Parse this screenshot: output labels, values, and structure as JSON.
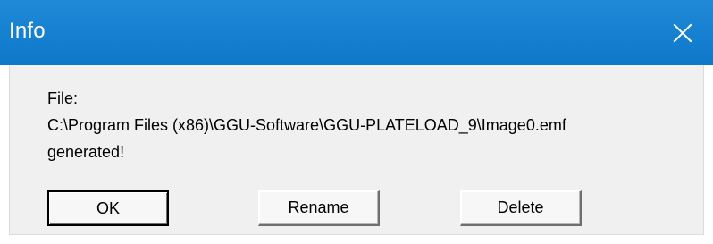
{
  "window": {
    "title": "Info",
    "close_icon": "close-icon"
  },
  "message": {
    "line1": "File:",
    "line2": "C:\\Program Files (x86)\\GGU-Software\\GGU-PLATELOAD_9\\Image0.emf",
    "line3": "generated!"
  },
  "buttons": {
    "ok_label": "OK",
    "rename_label": "Rename",
    "delete_label": "Delete"
  },
  "colors": {
    "titlebar": "#1a84d4",
    "title_text": "#ffffff",
    "client_bg": "#f0f0f0",
    "button_face": "#f7f7f7",
    "text": "#000000"
  }
}
